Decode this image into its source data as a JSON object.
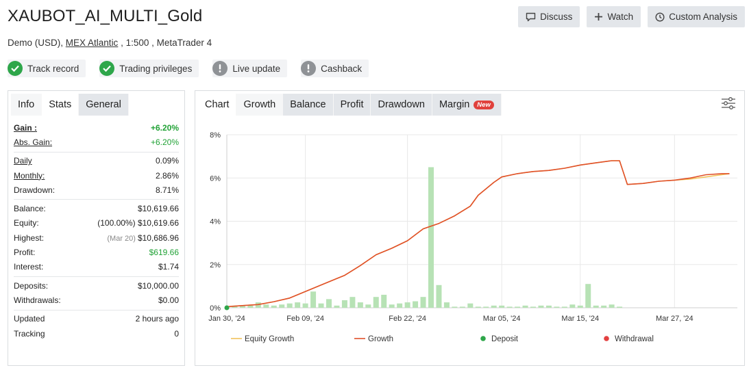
{
  "header": {
    "title": "XAUBOT_AI_MULTI_Gold",
    "account_type": "Demo (USD),",
    "broker": "MEX Atlantic",
    "leverage_platform": ", 1:500 , MetaTrader 4",
    "buttons": {
      "discuss": "Discuss",
      "watch": "Watch",
      "analysis": "Custom Analysis"
    }
  },
  "badges": [
    {
      "label": "Track record",
      "status": "verified",
      "icon": "check-icon"
    },
    {
      "label": "Trading privileges",
      "status": "verified",
      "icon": "check-icon"
    },
    {
      "label": "Live update",
      "status": "not-verified",
      "icon": "exclamation-icon"
    },
    {
      "label": "Cashback",
      "status": "not-verified",
      "icon": "exclamation-icon"
    }
  ],
  "left_panel": {
    "tabs": [
      "Info",
      "Stats",
      "General"
    ],
    "stats": {
      "gain": {
        "label": "Gain :",
        "value": "+6.20%"
      },
      "abs_gain": {
        "label": "Abs. Gain:",
        "value": "+6.20%"
      },
      "daily": {
        "label": "Daily",
        "value": "0.09%"
      },
      "monthly": {
        "label": "Monthly:",
        "value": "2.86%"
      },
      "drawdown": {
        "label": "Drawdown:",
        "value": "8.71%"
      },
      "balance": {
        "label": "Balance:",
        "value": "$10,619.66"
      },
      "equity": {
        "label": "Equity:",
        "note": "(100.00%)",
        "value": "$10,619.66"
      },
      "highest": {
        "label": "Highest:",
        "note": "(Mar 20)",
        "value": "$10,686.96"
      },
      "profit": {
        "label": "Profit:",
        "value": "$619.66"
      },
      "interest": {
        "label": "Interest:",
        "value": "$1.74"
      },
      "deposits": {
        "label": "Deposits:",
        "value": "$10,000.00"
      },
      "withdrawals": {
        "label": "Withdrawals:",
        "value": "$0.00"
      },
      "updated": {
        "label": "Updated",
        "value": "2 hours ago"
      },
      "tracking": {
        "label": "Tracking",
        "value": "0"
      }
    }
  },
  "right_panel": {
    "tabs": [
      "Chart",
      "Growth",
      "Balance",
      "Profit",
      "Drawdown",
      "Margin"
    ],
    "new_badge": "New"
  },
  "colors": {
    "equity_line": "#f2c25a",
    "growth_line": "#e0502a",
    "bars": "#b7e2b5",
    "deposit": "#2ea64a",
    "withdrawal": "#e34040"
  },
  "chart_data": {
    "type": "line",
    "yticks": [
      "0%",
      "2%",
      "4%",
      "6%",
      "8%"
    ],
    "ylim": [
      0,
      8
    ],
    "xlim": [
      0,
      65
    ],
    "xticks": [
      {
        "label": "Jan 30, '24",
        "day": 0
      },
      {
        "label": "Feb 09, '24",
        "day": 10
      },
      {
        "label": "Feb 22, '24",
        "day": 23
      },
      {
        "label": "Mar 05, '24",
        "day": 35
      },
      {
        "label": "Mar 15, '24",
        "day": 45
      },
      {
        "label": "Mar 27, '24",
        "day": 57
      }
    ],
    "legend": [
      "Equity Growth",
      "Growth",
      "Deposit",
      "Withdrawal"
    ],
    "growth": [
      [
        0,
        0.05
      ],
      [
        2,
        0.1
      ],
      [
        4,
        0.15
      ],
      [
        6,
        0.28
      ],
      [
        8,
        0.45
      ],
      [
        10,
        0.75
      ],
      [
        12,
        1.05
      ],
      [
        14,
        1.35
      ],
      [
        15,
        1.5
      ],
      [
        17,
        1.95
      ],
      [
        19,
        2.45
      ],
      [
        21,
        2.75
      ],
      [
        23,
        3.1
      ],
      [
        25,
        3.65
      ],
      [
        27,
        3.9
      ],
      [
        29,
        4.25
      ],
      [
        31,
        4.7
      ],
      [
        32,
        5.2
      ],
      [
        34,
        5.8
      ],
      [
        35,
        6.05
      ],
      [
        37,
        6.2
      ],
      [
        39,
        6.3
      ],
      [
        41,
        6.35
      ],
      [
        43,
        6.45
      ],
      [
        45,
        6.6
      ],
      [
        47,
        6.7
      ],
      [
        49,
        6.8
      ],
      [
        50,
        6.8
      ],
      [
        51,
        5.7
      ],
      [
        53,
        5.75
      ],
      [
        55,
        5.85
      ],
      [
        57,
        5.9
      ],
      [
        59,
        6.0
      ],
      [
        61,
        6.15
      ],
      [
        63,
        6.2
      ],
      [
        64,
        6.2
      ]
    ],
    "equity_growth": [
      [
        0,
        0.05
      ],
      [
        2,
        0.1
      ],
      [
        4,
        0.15
      ],
      [
        6,
        0.28
      ],
      [
        8,
        0.45
      ],
      [
        10,
        0.75
      ],
      [
        12,
        1.05
      ],
      [
        14,
        1.35
      ],
      [
        15,
        1.5
      ],
      [
        17,
        1.95
      ],
      [
        19,
        2.45
      ],
      [
        21,
        2.75
      ],
      [
        23,
        3.1
      ],
      [
        25,
        3.65
      ],
      [
        27,
        3.9
      ],
      [
        29,
        4.25
      ],
      [
        31,
        4.7
      ],
      [
        32,
        5.2
      ],
      [
        34,
        5.8
      ],
      [
        35,
        6.05
      ],
      [
        37,
        6.2
      ],
      [
        39,
        6.3
      ],
      [
        41,
        6.35
      ],
      [
        43,
        6.45
      ],
      [
        45,
        6.6
      ],
      [
        47,
        6.7
      ],
      [
        49,
        6.8
      ],
      [
        50,
        6.8
      ],
      [
        51,
        5.7
      ],
      [
        53,
        5.75
      ],
      [
        55,
        5.85
      ],
      [
        57,
        5.9
      ],
      [
        59,
        5.95
      ],
      [
        61,
        6.05
      ],
      [
        63,
        6.15
      ],
      [
        64,
        6.2
      ]
    ],
    "daily_bars": [
      [
        1,
        0.1
      ],
      [
        2,
        0.1
      ],
      [
        3,
        0.1
      ],
      [
        4,
        0.25
      ],
      [
        5,
        0.15
      ],
      [
        6,
        0.1
      ],
      [
        7,
        0.15
      ],
      [
        8,
        0.2
      ],
      [
        9,
        0.25
      ],
      [
        10,
        0.2
      ],
      [
        11,
        0.75
      ],
      [
        12,
        0.2
      ],
      [
        13,
        0.4
      ],
      [
        14,
        0.1
      ],
      [
        15,
        0.35
      ],
      [
        16,
        0.5
      ],
      [
        17,
        0.25
      ],
      [
        18,
        0.15
      ],
      [
        19,
        0.5
      ],
      [
        20,
        0.6
      ],
      [
        21,
        0.15
      ],
      [
        22,
        0.2
      ],
      [
        23,
        0.25
      ],
      [
        24,
        0.3
      ],
      [
        25,
        0.5
      ],
      [
        26,
        6.5
      ],
      [
        27,
        1.05
      ],
      [
        28,
        0.25
      ],
      [
        29,
        0.05
      ],
      [
        30,
        0.05
      ],
      [
        31,
        0.2
      ],
      [
        32,
        0.05
      ],
      [
        33,
        0.05
      ],
      [
        34,
        0.1
      ],
      [
        35,
        0.1
      ],
      [
        36,
        0.05
      ],
      [
        37,
        0.05
      ],
      [
        38,
        0.1
      ],
      [
        39,
        0.05
      ],
      [
        40,
        0.1
      ],
      [
        41,
        0.1
      ],
      [
        42,
        0.05
      ],
      [
        43,
        0.05
      ],
      [
        44,
        0.15
      ],
      [
        45,
        0.1
      ],
      [
        46,
        1.1
      ],
      [
        47,
        0.1
      ],
      [
        48,
        0.1
      ],
      [
        49,
        0.15
      ],
      [
        50,
        0.05
      ]
    ],
    "deposits": [
      [
        0,
        0
      ]
    ]
  }
}
